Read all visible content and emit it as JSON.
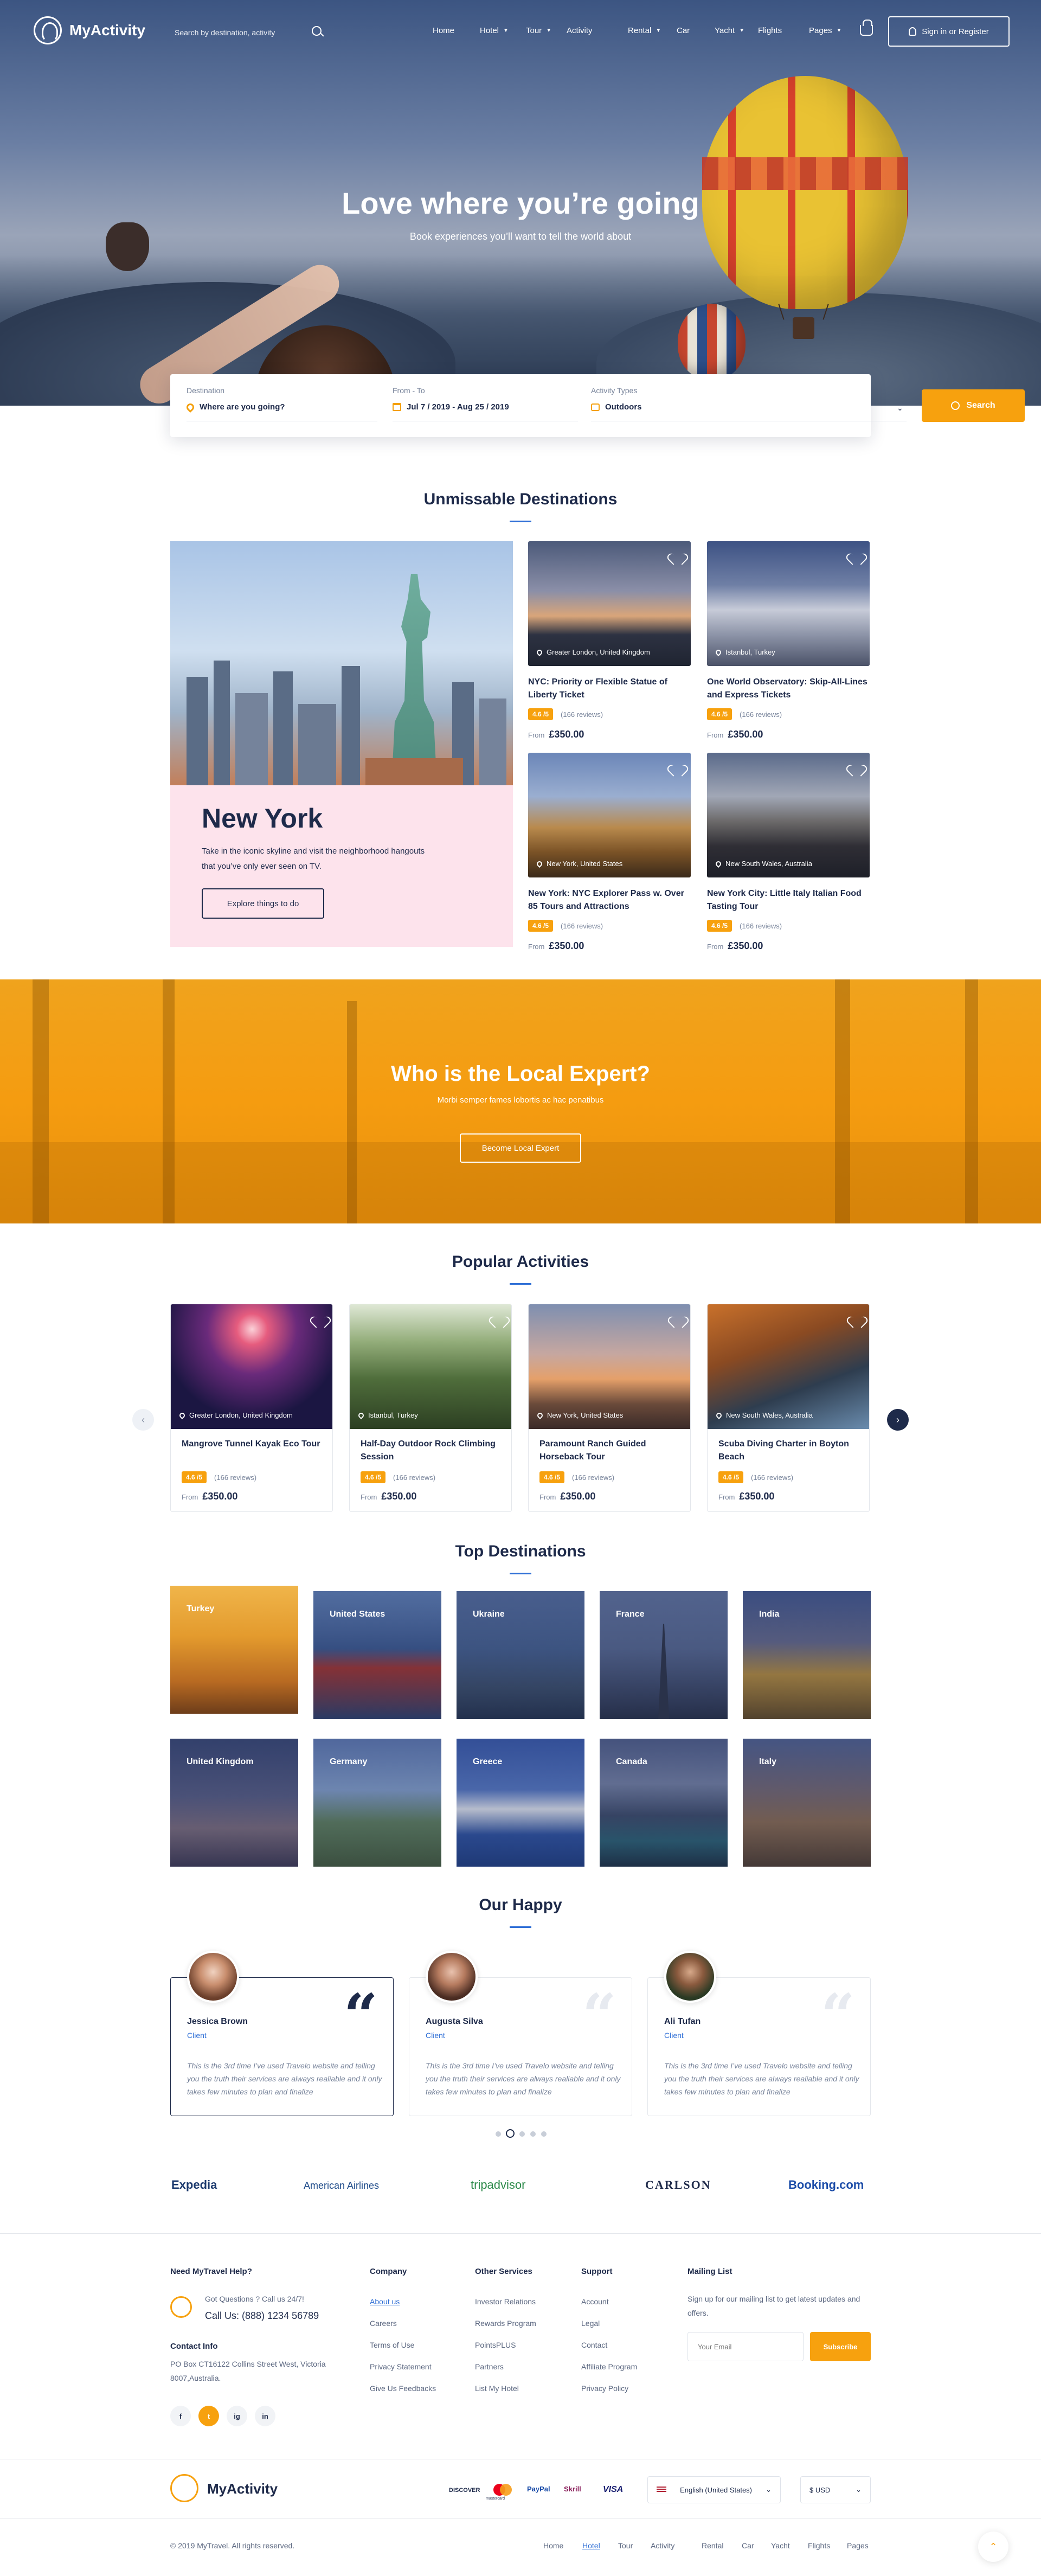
{
  "header": {
    "logo": "MyActivity",
    "search_placeholder": "Search by destination, activity",
    "nav": [
      "Home",
      "Hotel",
      "Tour",
      "Activity",
      "Rental",
      "Car",
      "Yacht",
      "Flights",
      "Pages"
    ],
    "signin": "Sign in or Register"
  },
  "hero": {
    "title": "Love where you’re going",
    "subtitle": "Book experiences you’ll want to tell the world about"
  },
  "search_box": {
    "destination_label": "Destination",
    "destination_value": "Where are you going?",
    "dates_label": "From - To",
    "dates_value": "Jul 7 / 2019 - Aug 25 / 2019",
    "type_label": "Activity Types",
    "type_value": "Outdoors",
    "button": "Search"
  },
  "destinations": {
    "title": "Unmissable Destinations",
    "feature": {
      "title": "New York",
      "description": "Take in the iconic skyline and visit the neighborhood hangouts that you’ve only ever seen on TV.",
      "button": "Explore things to do"
    },
    "cards": [
      {
        "location": "Greater London, United Kingdom",
        "title": "NYC: Priority or Flexible Statue of Liberty Ticket",
        "rating": "4.6 /5",
        "reviews": "(166 reviews)",
        "from": "From",
        "price": "£350.00"
      },
      {
        "location": "Istanbul, Turkey",
        "title": "One World Observatory: Skip-All-Lines and Express Tickets",
        "rating": "4.6 /5",
        "reviews": "(166 reviews)",
        "from": "From",
        "price": "£350.00"
      },
      {
        "location": "New York, United States",
        "title": "New York: NYC Explorer Pass w. Over 85 Tours and Attractions",
        "rating": "4.6 /5",
        "reviews": "(166 reviews)",
        "from": "From",
        "price": "£350.00"
      },
      {
        "location": "New South Wales, Australia",
        "title": "New York City: Little Italy Italian Food Tasting Tour",
        "rating": "4.6 /5",
        "reviews": "(166 reviews)",
        "from": "From",
        "price": "£350.00"
      }
    ]
  },
  "expert": {
    "title": "Who is the Local Expert?",
    "subtitle": "Morbi semper fames lobortis ac hac penatibus",
    "button": "Become Local Expert"
  },
  "activities": {
    "title": "Popular Activities",
    "cards": [
      {
        "location": "Greater London, United Kingdom",
        "title": "Mangrove Tunnel Kayak Eco Tour",
        "rating": "4.6 /5",
        "reviews": "(166 reviews)",
        "from": "From",
        "price": "£350.00"
      },
      {
        "location": "Istanbul, Turkey",
        "title": "Half-Day Outdoor Rock Climbing Session",
        "rating": "4.6 /5",
        "reviews": "(166 reviews)",
        "from": "From",
        "price": "£350.00"
      },
      {
        "location": "New York, United States",
        "title": "Paramount Ranch Guided Horseback Tour",
        "rating": "4.6 /5",
        "reviews": "(166 reviews)",
        "from": "From",
        "price": "£350.00"
      },
      {
        "location": "New South Wales, Australia",
        "title": "Scuba Diving Charter in Boyton Beach",
        "rating": "4.6 /5",
        "reviews": "(166 reviews)",
        "from": "From",
        "price": "£350.00"
      }
    ]
  },
  "top_destinations": {
    "title": "Top Destinations",
    "items": [
      "Turkey",
      "United States",
      "Ukraine",
      "France",
      "India",
      "United Kingdom",
      "Germany",
      "Greece",
      "Canada",
      "Italy"
    ]
  },
  "testimonials": {
    "title": "Our Happy",
    "items": [
      {
        "name": "Jessica Brown",
        "role": "Client",
        "text": "This is the 3rd time I’ve used Travelo website and telling you the truth their services are always realiable and it only takes few minutes to plan and finalize"
      },
      {
        "name": "Augusta Silva",
        "role": "Client",
        "text": "This is the 3rd time I’ve used Travelo website and telling you the truth their services are always realiable and it only takes few minutes to plan and finalize"
      },
      {
        "name": "Ali Tufan",
        "role": "Client",
        "text": "This is the 3rd time I’ve used Travelo website and telling you the truth their services are always realiable and it only takes few minutes to plan and finalize"
      }
    ]
  },
  "partners": [
    "Expedia",
    "American Airlines",
    "tripadvisor",
    "CARLSON",
    "Booking.com"
  ],
  "footer": {
    "help_title": "Need MyTravel Help?",
    "help_question": "Got Questions ? Call us 24/7!",
    "help_phone": "Call Us: (888) 1234 56789",
    "contact_title": "Contact Info",
    "contact_address": "PO Box CT16122 Collins Street West, Victoria 8007,Australia.",
    "social": [
      "f",
      "t",
      "ig",
      "in"
    ],
    "company_title": "Company",
    "company_links": [
      "About us",
      "Careers",
      "Terms of Use",
      "Privacy Statement",
      "Give Us Feedbacks"
    ],
    "services_title": "Other Services",
    "services_links": [
      "Investor Relations",
      "Rewards Program",
      "PointsPLUS",
      "Partners",
      "List My Hotel"
    ],
    "support_title": "Support",
    "support_links": [
      "Account",
      "Legal",
      "Contact",
      "Affiliate Program",
      "Privacy Policy"
    ],
    "mailing_title": "Mailing List",
    "mailing_text": "Sign up for our mailing list to get latest updates and offers.",
    "email_placeholder": "Your Email",
    "subscribe": "Subscribe",
    "logo": "MyActivity",
    "payments": [
      "DISCOVER",
      "mastercard",
      "PayPal",
      "Skrill",
      "VISA"
    ],
    "language": "English (United States)",
    "currency": "$ USD",
    "copyright": "© 2019 MyTravel. All rights reserved.",
    "bottom_links": [
      "Home",
      "Hotel",
      "Tour",
      "Activity",
      "Rental",
      "Car",
      "Yacht",
      "Flights",
      "Pages"
    ]
  },
  "colors": {
    "accent": "#f7a10e",
    "primary": "#1e2a4a",
    "link": "#2f6fd6"
  }
}
